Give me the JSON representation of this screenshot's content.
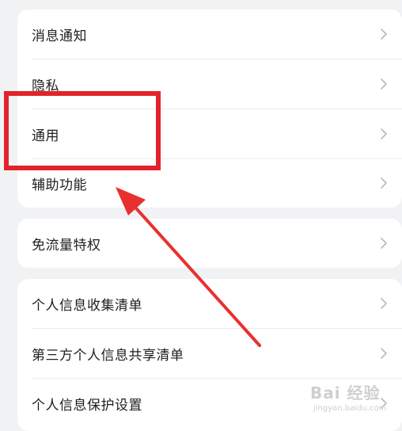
{
  "groups": [
    {
      "items": [
        {
          "label": "消息通知"
        },
        {
          "label": "隐私"
        },
        {
          "label": "通用"
        },
        {
          "label": "辅助功能"
        }
      ]
    },
    {
      "items": [
        {
          "label": "免流量特权"
        }
      ]
    },
    {
      "items": [
        {
          "label": "个人信息收集清单"
        },
        {
          "label": "第三方个人信息共享清单"
        },
        {
          "label": "个人信息保护设置"
        }
      ]
    }
  ],
  "annotation": {
    "highlight_color": "#e2232b",
    "arrow_color": "#e8312f"
  },
  "icons": {
    "chevron": "chevron-right-icon"
  },
  "watermark": {
    "main": "Bai 经验",
    "sub": "jingyan.baidu.com"
  }
}
